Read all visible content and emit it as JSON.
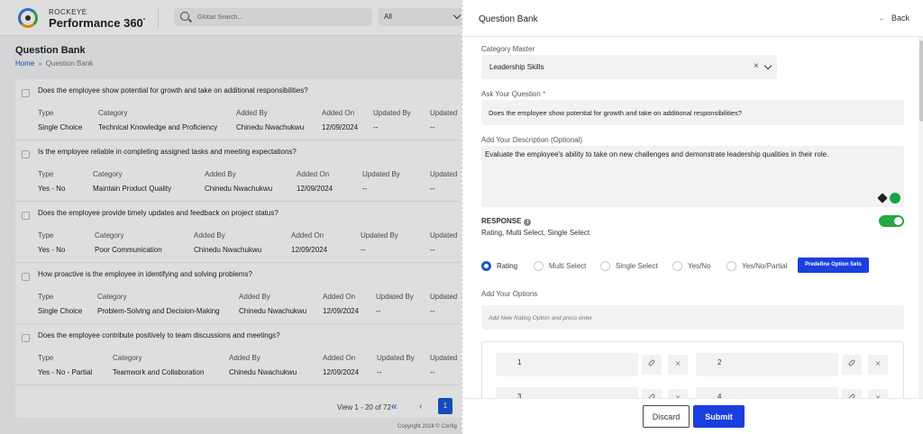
{
  "brand": {
    "small": "ROCKEYE",
    "name": "Performance 360",
    "mark": "°"
  },
  "header": {
    "search_placeholder": "Global Search...",
    "scope": "All"
  },
  "page": {
    "title": "Question Bank",
    "breadcrumb": [
      "Home",
      "»",
      "Question Bank"
    ]
  },
  "questions": [
    {
      "text": "Does the employee show potential for growth and take on additional responsibilities?",
      "labels": [
        "Type",
        "Category",
        "Added By",
        "Added On",
        "Updated By",
        "Updated"
      ],
      "values": [
        "Single Choice",
        "Technical Knowledge and Proficiency",
        "Chinedu Nwachukwu",
        "12/09/2024",
        "--",
        "--"
      ]
    },
    {
      "text": "Is the employee reliable in completing assigned tasks and meeting expectations?",
      "labels": [
        "Type",
        "Category",
        "Added By",
        "Added On",
        "Updated By",
        "Updated"
      ],
      "values": [
        "Yes - No",
        "Maintain Product Quality",
        "Chinedu Nwachukwu",
        "12/09/2024",
        "--",
        "--"
      ]
    },
    {
      "text": "Does the employee provide timely updates and feedback on project status?",
      "labels": [
        "Type",
        "Category",
        "Added By",
        "Added On",
        "Updated By",
        "Updated"
      ],
      "values": [
        "Yes - No",
        "Poor Communication",
        "Chinedu Nwachukwu",
        "12/09/2024",
        "--",
        "--"
      ]
    },
    {
      "text": "How proactive is the employee in identifying and solving problems?",
      "labels": [
        "Type",
        "Category",
        "Added By",
        "Added On",
        "Updated By",
        "Updated"
      ],
      "values": [
        "Single Choice",
        "Problem-Solving and Decision-Making",
        "Chinedu Nwachukwu",
        "12/09/2024",
        "--",
        "--"
      ]
    },
    {
      "text": "Does the employee contribute positively to team discussions and meetings?",
      "labels": [
        "Type",
        "Category",
        "Added By",
        "Added On",
        "Updated By",
        "Updated"
      ],
      "values": [
        "Yes - No - Partial",
        "Teamwork and Collaboration",
        "Chinedu Nwachukwu",
        "12/09/2024",
        "--",
        "--"
      ]
    }
  ],
  "pager": {
    "text": "View 1 - 20 of 72",
    "first": "«",
    "prev": "‹",
    "page": "1"
  },
  "copyright": "Copyright 2024 © Config",
  "drawer": {
    "title": "Question Bank",
    "back_arrow": "←",
    "back": "Back",
    "category_label": "Category Master",
    "category_value": "Leadership Skills",
    "clear": "×",
    "question_label": "Ask Your Question",
    "required_mark": "*",
    "question_value": "Does the employee show potential for growth and take on additional responsibilities?",
    "desc_label": "Add Your Description (Optional)",
    "desc_value": "Evaluate the employee's ability to take on new challenges and demonstrate leadership qualities in their role.",
    "response_title": "RESPONSE",
    "info": "i",
    "response_sub": "Rating, Multi Select, Single Select",
    "response_on": true,
    "response_types": [
      "Rating",
      "Multi Select",
      "Single Select",
      "Yes/No",
      "Yes/No/Partial"
    ],
    "selected_type": "Rating",
    "predefine": "Predefine Option Sets",
    "options_label": "Add Your Options",
    "options_placeholder": "Add New Rating Option and press enter",
    "options": [
      "1",
      "2",
      "3",
      "4"
    ],
    "remove": "×",
    "discard": "Discard",
    "submit": "Submit"
  },
  "colors": {
    "primary": "#1a3fe0",
    "link": "#1a57d6",
    "toggle_on": "#27a844"
  }
}
